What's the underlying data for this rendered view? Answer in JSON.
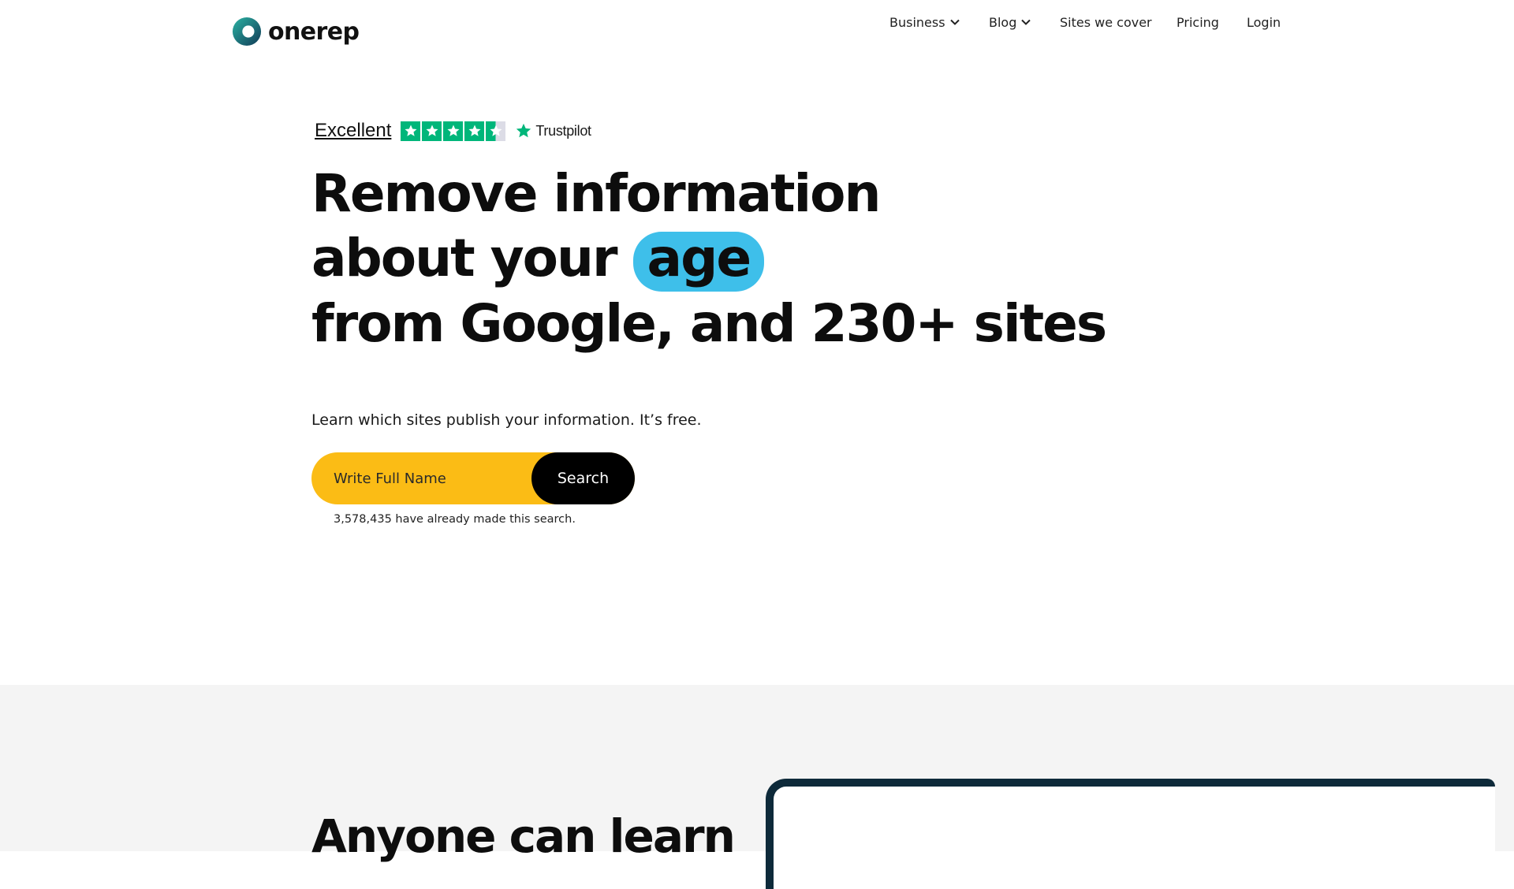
{
  "brand": {
    "name": "onerep",
    "accent": "#3ebfea",
    "logo_gradient": [
      "#1fa39a",
      "#16425a"
    ]
  },
  "nav": {
    "items": [
      {
        "label": "Business",
        "has_dropdown": true
      },
      {
        "label": "Blog",
        "has_dropdown": true
      },
      {
        "label": "Sites we cover",
        "has_dropdown": false
      },
      {
        "label": "Pricing",
        "has_dropdown": false
      },
      {
        "label": "Login",
        "has_dropdown": false
      }
    ]
  },
  "trustpilot": {
    "rating_label": "Excellent",
    "stars": 4.5,
    "brand": "Trustpilot",
    "star_color": "#00b67a"
  },
  "hero": {
    "line1": "Remove information",
    "line2_prefix": "about your",
    "highlight": "age",
    "line3": "from Google, and 230+ sites",
    "subtext": "Learn which sites publish your information. It’s free.",
    "search": {
      "placeholder": "Write Full Name",
      "button_label": "Search",
      "background": "#fbbc15"
    },
    "search_count": "3,578,435 have already made this search."
  },
  "lower": {
    "heading": "Anyone can learn"
  }
}
